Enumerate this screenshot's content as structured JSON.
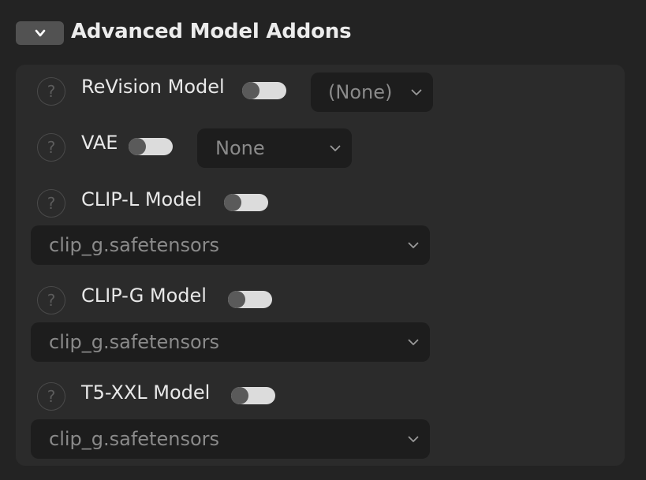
{
  "section": {
    "title": "Advanced Model Addons",
    "toggle_icon": "chevron-down-icon"
  },
  "help_glyph": "?",
  "rows": {
    "revision": {
      "label": "ReVision Model",
      "enabled": false,
      "select_value": "(None)"
    },
    "vae": {
      "label": "VAE",
      "enabled": false,
      "select_value": "None"
    },
    "clip_l": {
      "label": "CLIP-L Model",
      "enabled": false,
      "select_value": "clip_g.safetensors"
    },
    "clip_g": {
      "label": "CLIP-G Model",
      "enabled": false,
      "select_value": "clip_g.safetensors"
    },
    "t5_xxl": {
      "label": "T5-XXL Model",
      "enabled": false,
      "select_value": "clip_g.safetensors"
    }
  },
  "colors": {
    "background": "#232323",
    "panel": "#2b2b2b",
    "select_bg": "#1d1d1d",
    "switch_track": "#dcdcdc",
    "switch_knob": "#5a5a5a"
  }
}
